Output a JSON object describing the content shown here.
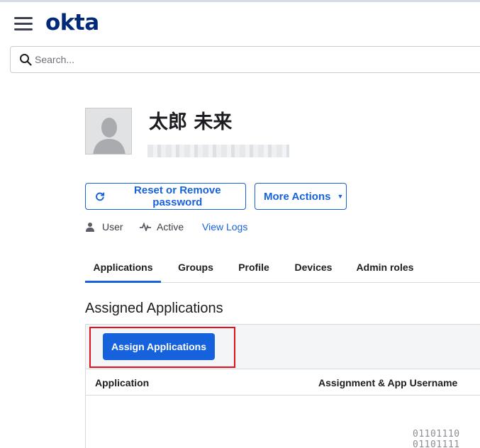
{
  "brand": {
    "logo_text": "okta",
    "logo_color": "#00297a",
    "accent": "#1662dd"
  },
  "search": {
    "placeholder": "Search...",
    "value": ""
  },
  "user": {
    "name": "太郎 未来",
    "type_label": "User",
    "status_label": "Active",
    "view_logs_label": "View Logs"
  },
  "actions": {
    "reset_label": "Reset or Remove password",
    "more_label": "More Actions"
  },
  "tabs": [
    {
      "label": "Applications",
      "active": true
    },
    {
      "label": "Groups",
      "active": false
    },
    {
      "label": "Profile",
      "active": false
    },
    {
      "label": "Devices",
      "active": false
    },
    {
      "label": "Admin roles",
      "active": false
    }
  ],
  "assigned": {
    "title": "Assigned Applications",
    "assign_button_label": "Assign Applications",
    "columns": [
      "Application",
      "Assignment & App Username"
    ],
    "empty_art_lines": [
      "01101110",
      "01101111"
    ]
  },
  "colors": {
    "highlight": "#e2111b"
  }
}
